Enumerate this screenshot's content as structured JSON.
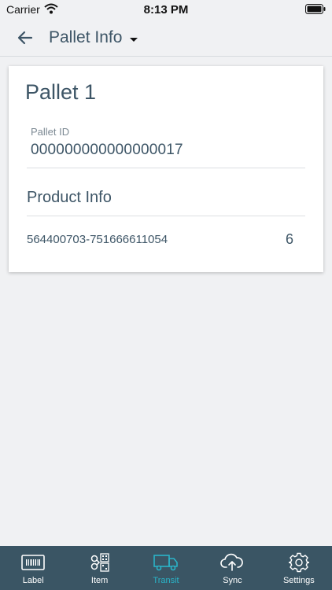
{
  "status_bar": {
    "carrier": "Carrier",
    "time": "8:13 PM"
  },
  "nav": {
    "title": "Pallet Info",
    "back_icon": "arrow-left-icon",
    "dropdown_icon": "caret-down-icon"
  },
  "card": {
    "title": "Pallet 1",
    "pallet_id_label": "Pallet ID",
    "pallet_id_value": "000000000000000017",
    "section_title": "Product Info",
    "products": [
      {
        "code": "564400703-751666611054",
        "qty": "6"
      }
    ]
  },
  "tabs": [
    {
      "label": "Label",
      "icon": "barcode-icon",
      "active": false
    },
    {
      "label": "Item",
      "icon": "item-qr-icon",
      "active": false
    },
    {
      "label": "Transit",
      "icon": "truck-icon",
      "active": true
    },
    {
      "label": "Sync",
      "icon": "cloud-upload-icon",
      "active": false
    },
    {
      "label": "Settings",
      "icon": "gear-icon",
      "active": false
    }
  ],
  "colors": {
    "accent": "#2ab4c8",
    "tab_bar": "#3a5564",
    "text": "#3d5566",
    "background": "#f0f1f3"
  }
}
